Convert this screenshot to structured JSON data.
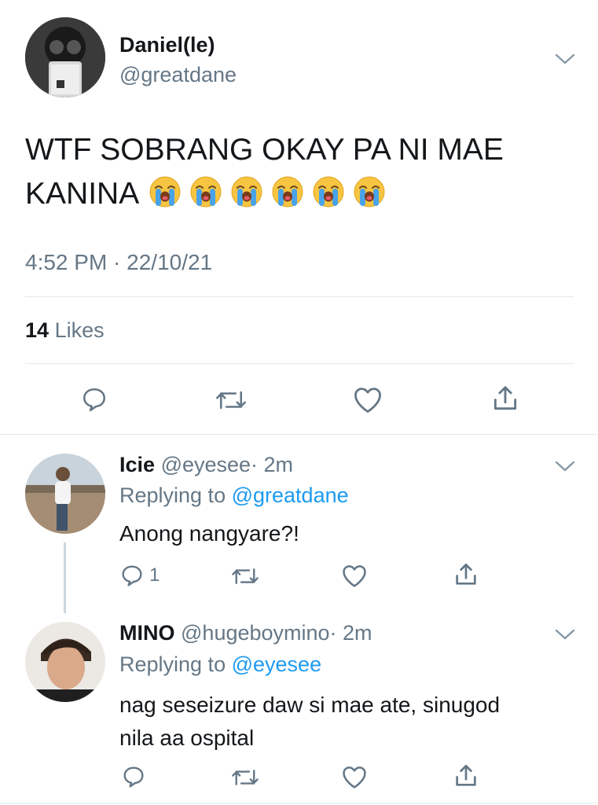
{
  "main_tweet": {
    "display_name": "Daniel(le)",
    "handle": "@greatdane",
    "text": "WTF SOBRANG OKAY PA NI MAE",
    "text_line2": "KANINA",
    "emoji": [
      "loudly-crying-face",
      "loudly-crying-face",
      "loudly-crying-face",
      "loudly-crying-face",
      "loudly-crying-face",
      "loudly-crying-face"
    ],
    "timestamp": "4:52 PM · 22/10/21",
    "likes_count": "14",
    "likes_label": "Likes"
  },
  "replies": [
    {
      "display_name": "Icie",
      "handle": "@eyesee",
      "time": "· 2m",
      "replying_prefix": "Replying to",
      "replying_to": "@greatdane",
      "text": "Anong nangyare?!",
      "reply_count": "1"
    },
    {
      "display_name": "MINO",
      "handle": "@hugeboymino",
      "time": "· 2m",
      "replying_prefix": "Replying to",
      "replying_to": "@eyesee",
      "text_line1": "nag seseizure daw si mae ate, sinugod",
      "text_line2": "nila aa ospital"
    }
  ],
  "colors": {
    "text": "#14171a",
    "muted": "#657786",
    "link": "#1d9bf0",
    "divider": "#e1e8ed"
  },
  "icons": [
    "reply-icon",
    "retweet-icon",
    "like-icon",
    "share-icon",
    "chevron-down-icon"
  ]
}
